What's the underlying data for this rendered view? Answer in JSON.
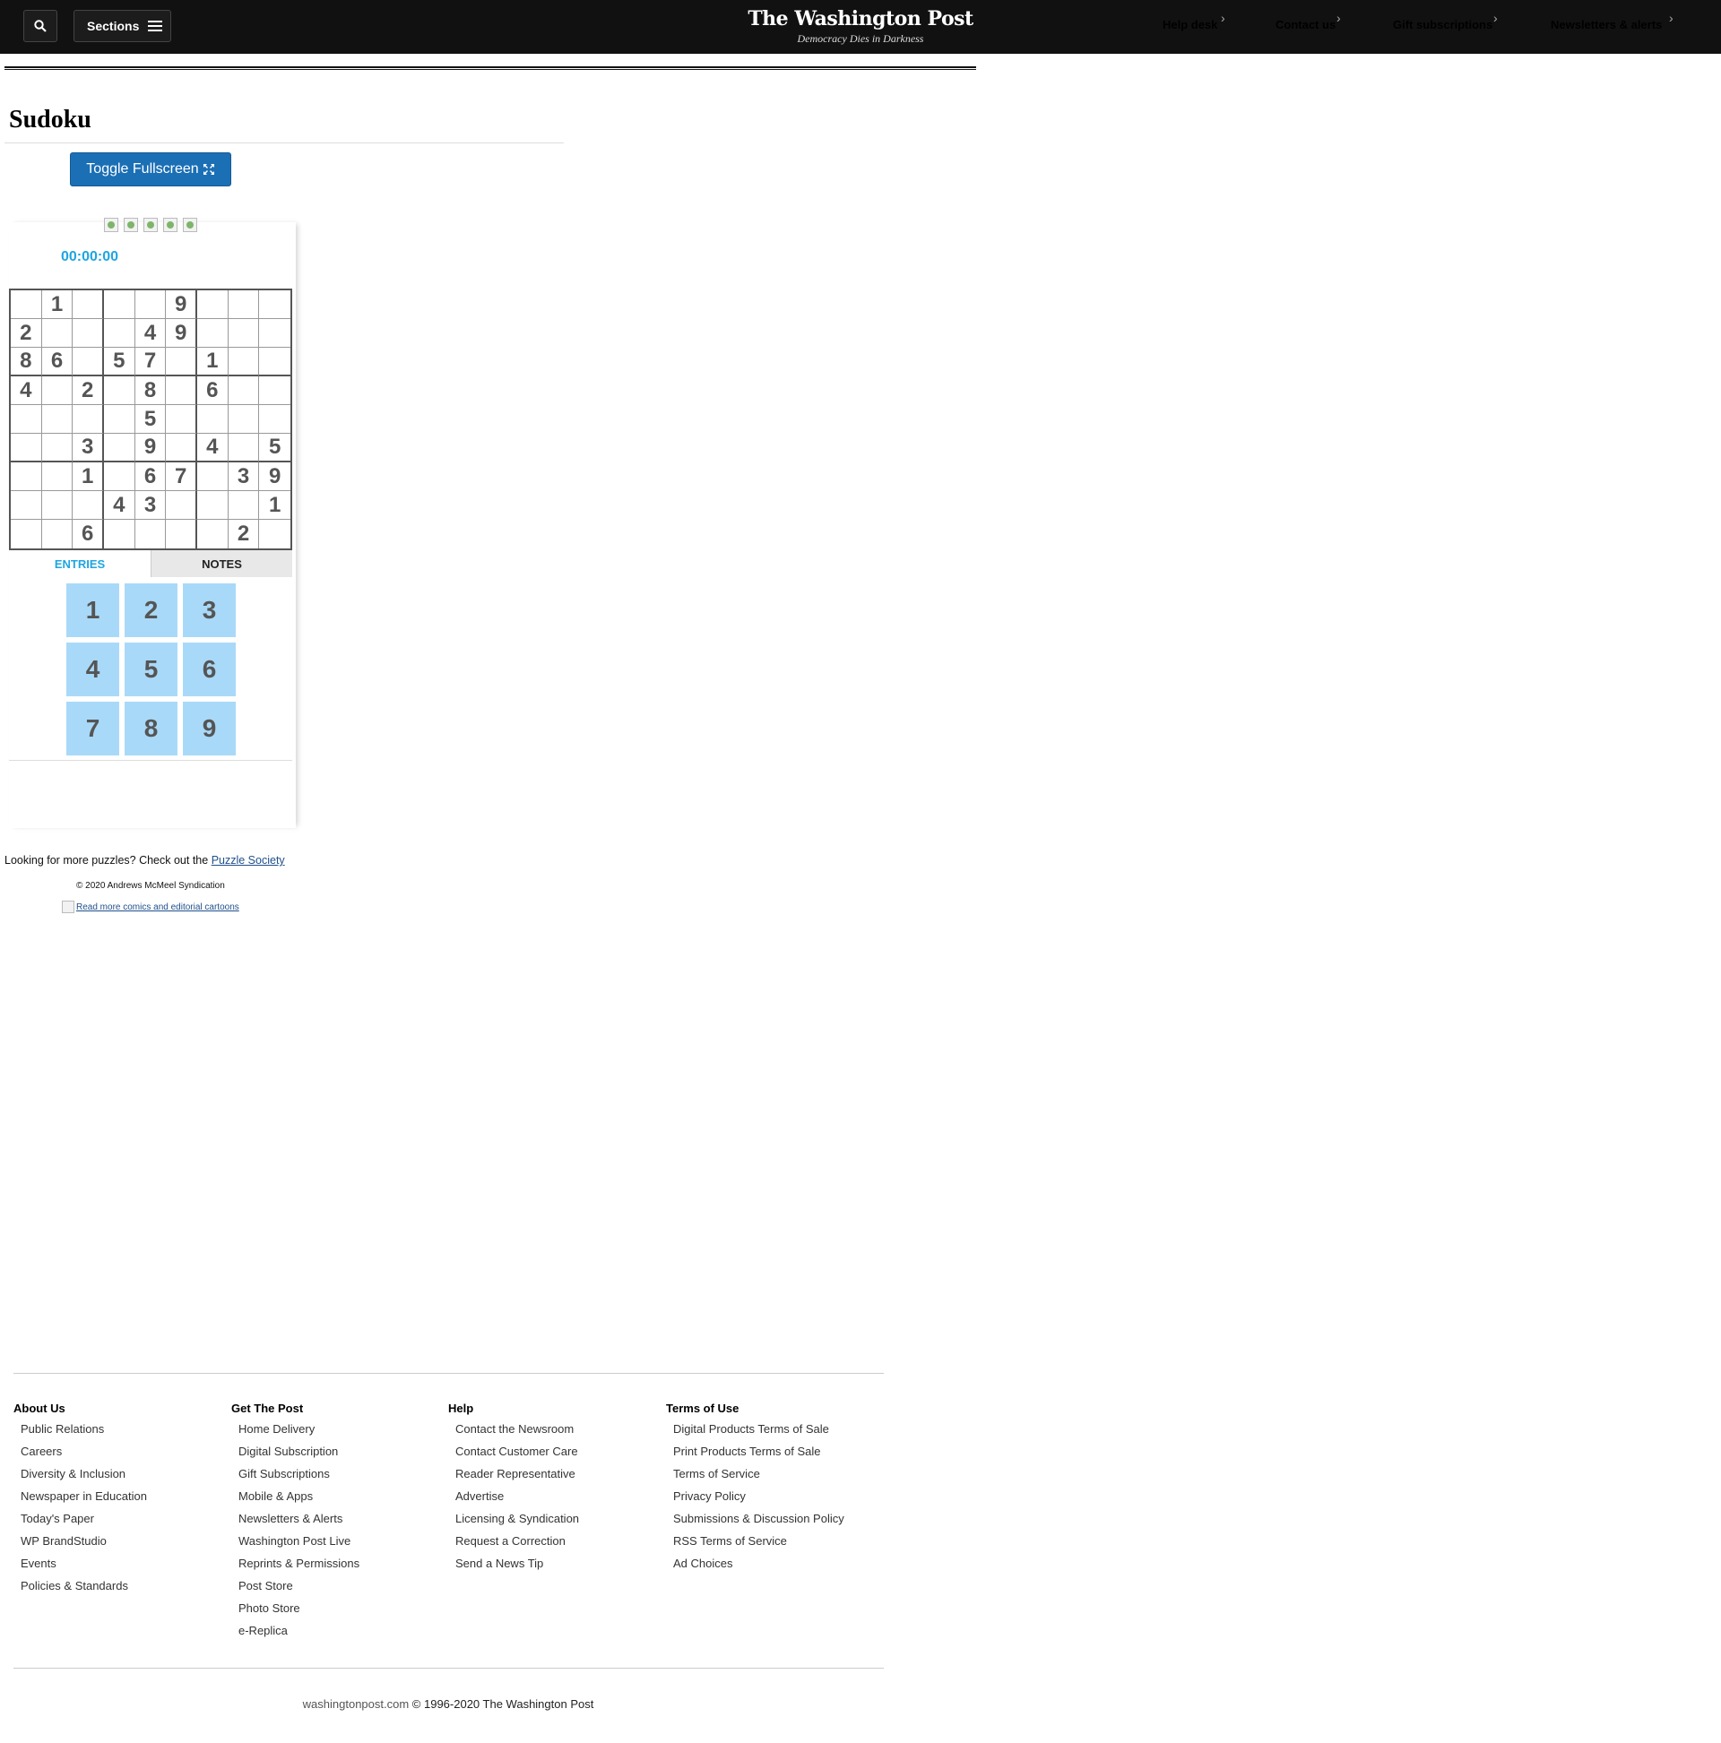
{
  "header": {
    "sections_label": "Sections",
    "logo_name": "The Washington Post",
    "logo_tagline": "Democracy Dies in Darkness",
    "links": [
      "Help desk",
      "Contact us",
      "Gift subscriptions",
      "Newsletters & alerts"
    ]
  },
  "page": {
    "title": "Sudoku",
    "fullscreen_label": "Toggle Fullscreen"
  },
  "game": {
    "timer": "00:00:00",
    "tabs": {
      "entries": "ENTRIES",
      "notes": "NOTES"
    },
    "grid": [
      [
        "",
        "1",
        "",
        "",
        "",
        "9",
        "",
        "",
        ""
      ],
      [
        "2",
        "",
        "",
        "",
        "4",
        "9",
        "",
        "",
        ""
      ],
      [
        "8",
        "6",
        "",
        "5",
        "7",
        "",
        "1",
        "",
        ""
      ],
      [
        "4",
        "",
        "2",
        "",
        "8",
        "",
        "6",
        "",
        ""
      ],
      [
        "",
        "",
        "",
        "",
        "5",
        "",
        "",
        "",
        ""
      ],
      [
        "",
        "",
        "3",
        "",
        "9",
        "",
        "4",
        "",
        "5"
      ],
      [
        "",
        "",
        "1",
        "",
        "6",
        "7",
        "",
        "3",
        "9"
      ],
      [
        "",
        "",
        "",
        "4",
        "3",
        "",
        "",
        "",
        "1"
      ],
      [
        "",
        "",
        "6",
        "",
        "",
        "",
        "",
        "2",
        ""
      ]
    ],
    "keypad": [
      "1",
      "2",
      "3",
      "4",
      "5",
      "6",
      "7",
      "8",
      "9"
    ]
  },
  "puzzles": {
    "text": "Looking for more puzzles? Check out the ",
    "link": "Puzzle Society",
    "copyright": "© 2020 Andrews McMeel Syndication",
    "comics_link": "Read more comics and editorial cartoons"
  },
  "footer": {
    "columns": [
      {
        "heading": "About Us",
        "links": [
          "Public Relations",
          "Careers",
          "Diversity & Inclusion",
          "Newspaper in Education",
          "Today's Paper",
          "WP BrandStudio",
          "Events",
          "Policies & Standards"
        ]
      },
      {
        "heading": "Get The Post",
        "links": [
          "Home Delivery",
          "Digital Subscription",
          "Gift Subscriptions",
          "Mobile & Apps",
          "Newsletters & Alerts",
          "Washington Post Live",
          "Reprints & Permissions",
          "Post Store",
          "Photo Store",
          "e-Replica"
        ]
      },
      {
        "heading": "Help",
        "links": [
          "Contact the Newsroom",
          "Contact Customer Care",
          "Reader Representative",
          "Advertise",
          "Licensing & Syndication",
          "Request a Correction",
          "Send a News Tip"
        ]
      },
      {
        "heading": "Terms of Use",
        "links": [
          "Digital Products Terms of Sale",
          "Print Products Terms of Sale",
          "Terms of Service",
          "Privacy Policy",
          "Submissions & Discussion Policy",
          "RSS Terms of Service",
          "Ad Choices"
        ]
      }
    ],
    "site": "washingtonpost.com",
    "copyright": "© 1996-2020 The Washington Post"
  }
}
